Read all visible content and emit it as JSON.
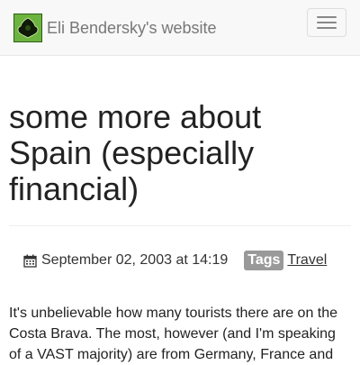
{
  "navbar": {
    "brand_text": "Eli Bendersky's website",
    "logo_icon": "fractal-logo-icon",
    "toggle_icon": "hamburger-menu-icon"
  },
  "post": {
    "title": "some more about Spain (especially financial)",
    "date": "September 02, 2003 at 14:19",
    "date_icon": "calendar-icon",
    "tags_label": "Tags",
    "tag": "Travel",
    "body": "It's unbelievable how many tourists there are on the Costa Brava. The most, however (and I'm speaking of a VAST majority) are from Germany, France and"
  },
  "colors": {
    "navbar_bg": "#f8f8f8",
    "logo_green": "#6db33f",
    "tags_badge": "#999999"
  }
}
